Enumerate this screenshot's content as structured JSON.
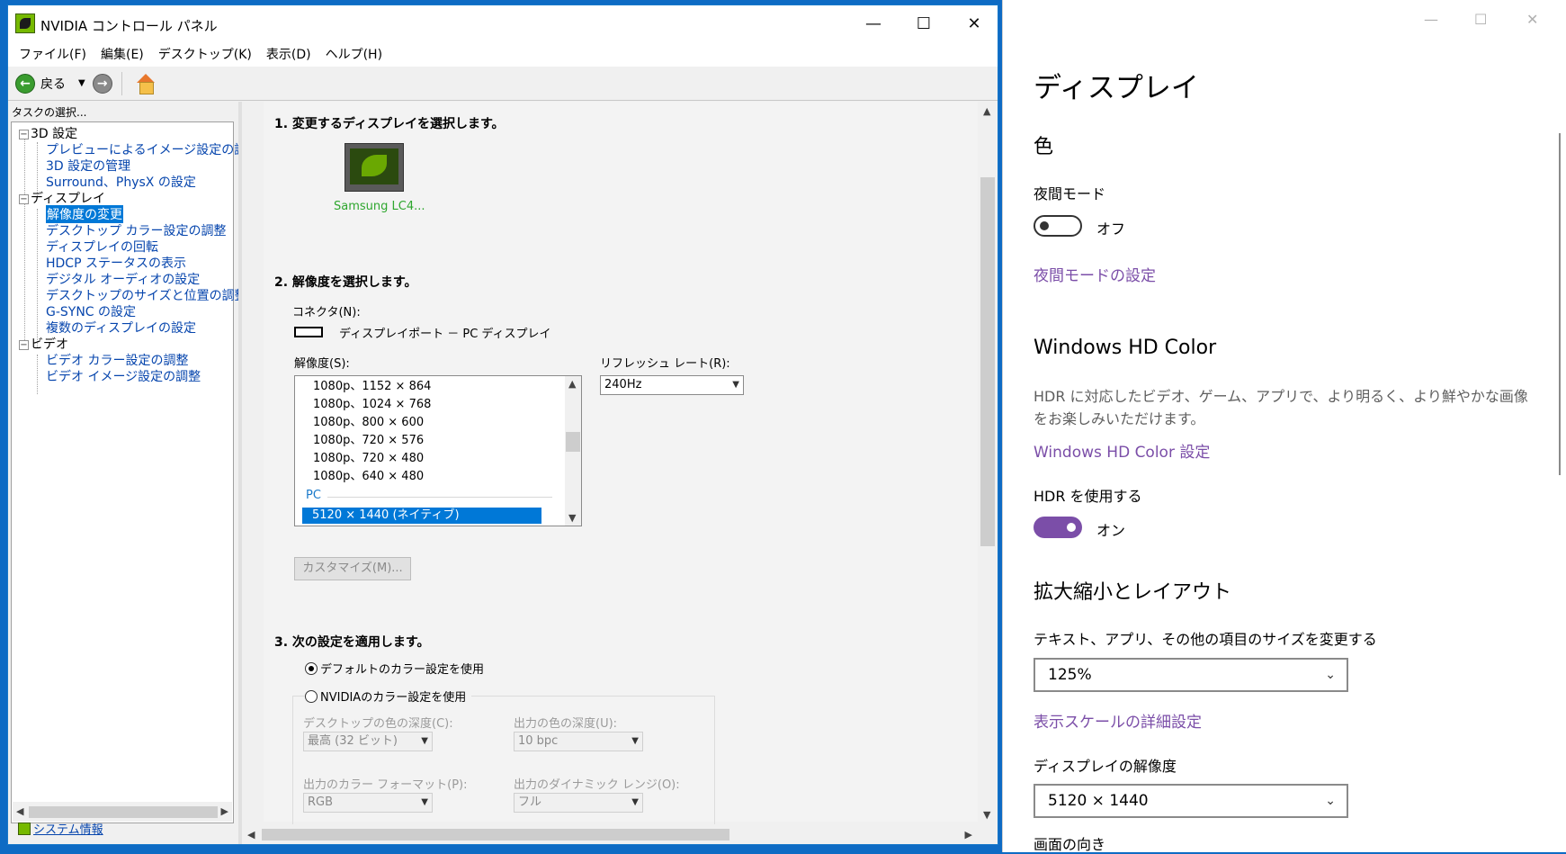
{
  "nvidia": {
    "title": "NVIDIA コントロール パネル",
    "menu": [
      "ファイル(F)",
      "編集(E)",
      "デスクトップ(K)",
      "表示(D)",
      "ヘルプ(H)"
    ],
    "toolbar": {
      "back_label": "戻る"
    },
    "task_label": "タスクの選択...",
    "tree": {
      "groups": [
        {
          "label": "3D 設定",
          "items": [
            "プレビューによるイメージ設定の調整",
            "3D 設定の管理",
            "Surround、PhysX の設定"
          ]
        },
        {
          "label": "ディスプレイ",
          "items": [
            "解像度の変更",
            "デスクトップ カラー設定の調整",
            "ディスプレイの回転",
            "HDCP ステータスの表示",
            "デジタル オーディオの設定",
            "デスクトップのサイズと位置の調整",
            "G-SYNC の設定",
            "複数のディスプレイの設定"
          ]
        },
        {
          "label": "ビデオ",
          "items": [
            "ビデオ カラー設定の調整",
            "ビデオ イメージ設定の調整"
          ]
        }
      ],
      "selected": "解像度の変更"
    },
    "sysinfo_link": "システム情報",
    "content": {
      "step1": "1. 変更するディスプレイを選択します。",
      "monitor_label": "Samsung LC4...",
      "step2": "2. 解像度を選択します。",
      "connector_label": "コネクタ(N):",
      "connector_value": "ディスプレイポート － PC ディスプレイ",
      "resolution_label": "解像度(S):",
      "resolutions": [
        "1080p、1152 × 864",
        "1080p、1024 × 768",
        "1080p、800 × 600",
        "1080p、720 × 576",
        "1080p、720 × 480",
        "1080p、640 × 480"
      ],
      "group_pc": "PC",
      "selected_resolution": "5120 × 1440 (ネイティブ)",
      "refresh_label": "リフレッシュ レート(R):",
      "refresh_value": "240Hz",
      "customize_button": "カスタマイズ(M)...",
      "step3": "3. 次の設定を適用します。",
      "radio_default": "デフォルトのカラー設定を使用",
      "radio_nvidia": "NVIDIAのカラー設定を使用",
      "desktop_depth_label": "デスクトップの色の深度(C):",
      "desktop_depth_value": "最高 (32 ビット)",
      "output_depth_label": "出力の色の深度(U):",
      "output_depth_value": "10 bpc",
      "color_format_label": "出力のカラー フォーマット(P):",
      "color_format_value": "RGB",
      "dynamic_range_label": "出力のダイナミック レンジ(O):",
      "dynamic_range_value": "フル"
    }
  },
  "settings": {
    "title": "ディスプレイ",
    "color_heading": "色",
    "night_mode_label": "夜間モード",
    "night_mode_state": "オフ",
    "night_mode_link": "夜間モードの設定",
    "hd_color_heading": "Windows HD Color",
    "hd_color_desc": "HDR に対応したビデオ、ゲーム、アプリで、より明るく、より鮮やかな画像をお楽しみいただけます。",
    "hd_color_link": "Windows HD Color 設定",
    "hdr_label": "HDR を使用する",
    "hdr_state": "オン",
    "scale_heading": "拡大縮小とレイアウト",
    "text_size_label": "テキスト、アプリ、その他の項目のサイズを変更する",
    "text_size_value": "125%",
    "scale_link": "表示スケールの詳細設定",
    "resolution_label": "ディスプレイの解像度",
    "resolution_value": "5120 × 1440",
    "orientation_label": "画面の向き"
  },
  "colors": {
    "accent_purple": "#7b4ea8",
    "selection_blue": "#0078d7",
    "nvidia_green": "#76b900"
  }
}
